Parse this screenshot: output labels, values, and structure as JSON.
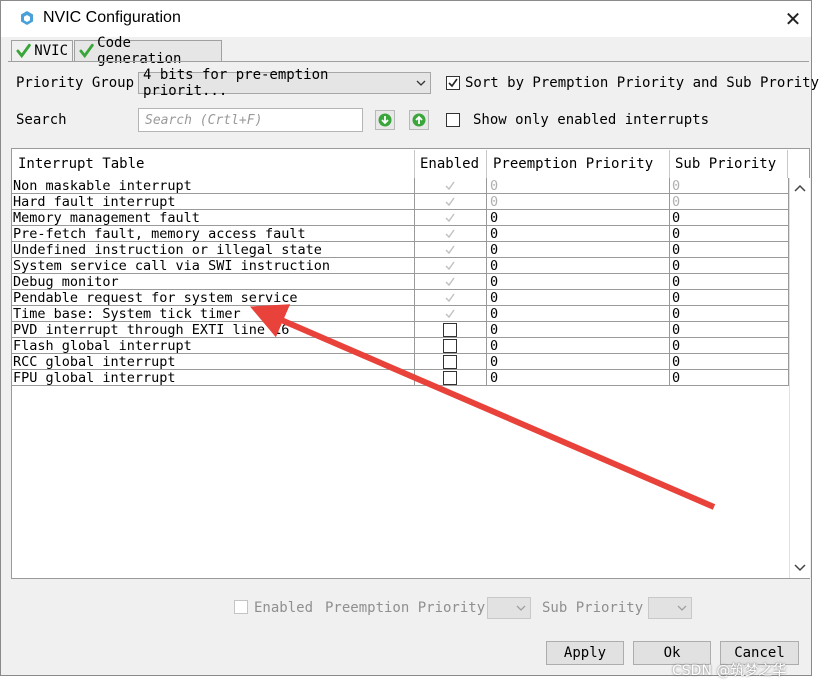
{
  "window": {
    "title": "NVIC Configuration",
    "close_glyph": "✕"
  },
  "tabs": [
    {
      "label": "NVIC",
      "active": true,
      "icon": "check-icon"
    },
    {
      "label": "Code generation",
      "active": false,
      "icon": "check-icon"
    }
  ],
  "priority_group": {
    "label": "Priority Group",
    "value": "4 bits for pre-emption priorit..."
  },
  "sort": {
    "label": "Sort by Premption Priority and Sub Prority",
    "checked": true
  },
  "search": {
    "label": "Search",
    "placeholder": "Search (Crtl+F)"
  },
  "show_only": {
    "label": "Show only enabled interrupts",
    "checked": false
  },
  "table": {
    "headers": [
      "Interrupt Table",
      "Enabled",
      "Preemption Priority",
      "Sub Priority"
    ],
    "rows": [
      {
        "name": "Non maskable interrupt",
        "enabled": "locked",
        "preemption": "0",
        "sub": "0",
        "editable": false
      },
      {
        "name": "Hard fault interrupt",
        "enabled": "locked",
        "preemption": "0",
        "sub": "0",
        "editable": false
      },
      {
        "name": "Memory management fault",
        "enabled": "locked",
        "preemption": "0",
        "sub": "0",
        "editable": true
      },
      {
        "name": "Pre-fetch fault, memory access fault",
        "enabled": "locked",
        "preemption": "0",
        "sub": "0",
        "editable": true
      },
      {
        "name": "Undefined instruction or illegal state",
        "enabled": "locked",
        "preemption": "0",
        "sub": "0",
        "editable": true
      },
      {
        "name": "System service call via SWI instruction",
        "enabled": "locked",
        "preemption": "0",
        "sub": "0",
        "editable": true
      },
      {
        "name": "Debug monitor",
        "enabled": "locked",
        "preemption": "0",
        "sub": "0",
        "editable": true
      },
      {
        "name": "Pendable request for system service",
        "enabled": "locked",
        "preemption": "0",
        "sub": "0",
        "editable": true
      },
      {
        "name": "Time base: System tick timer",
        "enabled": "locked",
        "preemption": "0",
        "sub": "0",
        "editable": true
      },
      {
        "name": "PVD interrupt through EXTI line 16",
        "enabled": "unchecked",
        "preemption": "0",
        "sub": "0",
        "editable": true
      },
      {
        "name": "Flash global interrupt",
        "enabled": "unchecked",
        "preemption": "0",
        "sub": "0",
        "editable": true
      },
      {
        "name": "RCC global interrupt",
        "enabled": "unchecked",
        "preemption": "0",
        "sub": "0",
        "editable": true
      },
      {
        "name": "FPU global interrupt",
        "enabled": "unchecked",
        "preemption": "0",
        "sub": "0",
        "editable": true
      }
    ]
  },
  "bottom": {
    "enabled_label": "Enabled",
    "preemption_label": "Preemption Priority",
    "sub_label": "Sub Priority"
  },
  "buttons": {
    "apply": "Apply",
    "ok": "Ok",
    "cancel": "Cancel"
  },
  "watermark": "CSDN @筑梦之华",
  "colors": {
    "accent_green": "#3aa53a",
    "annotation_red": "#e8423a"
  }
}
